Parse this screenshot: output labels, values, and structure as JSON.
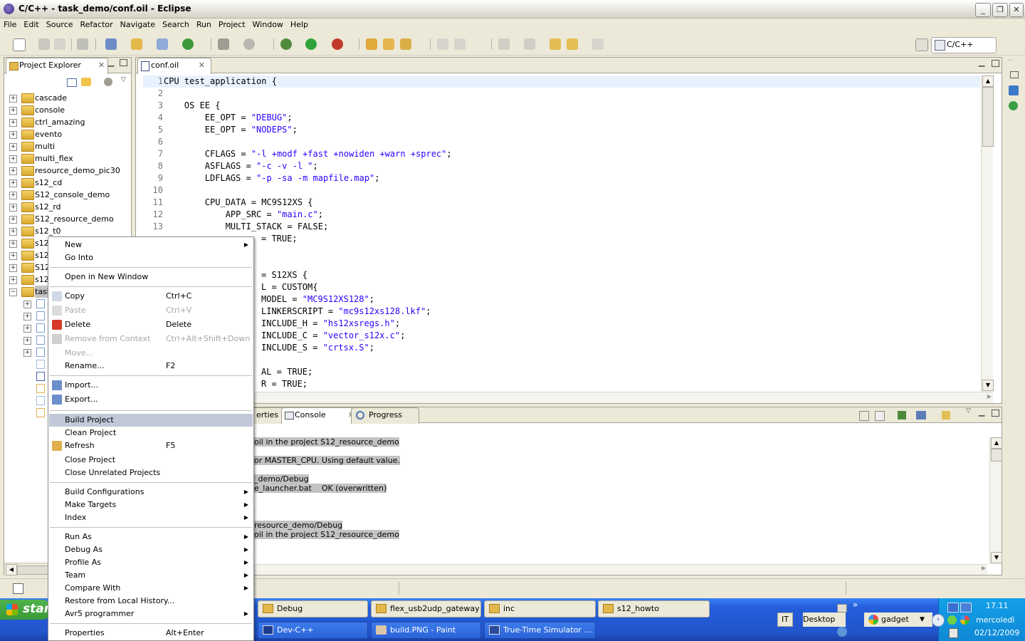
{
  "window": {
    "title": "C/C++ - task_demo/conf.oil - Eclipse"
  },
  "menubar": [
    "File",
    "Edit",
    "Source",
    "Refactor",
    "Navigate",
    "Search",
    "Run",
    "Project",
    "Window",
    "Help"
  ],
  "perspective": {
    "label": "C/C++"
  },
  "project_explorer": {
    "tab_label": "Project Explorer",
    "items": [
      "cascade",
      "console",
      "ctrl_amazing",
      "evento",
      "multi",
      "multi_flex",
      "resource_demo_pic30",
      "s12_cd",
      "S12_console_demo",
      "s12_rd",
      "S12_resource_demo",
      "s12_t0",
      "s12",
      "s12",
      "S12",
      "s12",
      "task"
    ]
  },
  "editor": {
    "tab_label": "conf.oil",
    "lines": [
      {
        "n": "1",
        "text": "CPU test_application {"
      },
      {
        "n": "2",
        "text": ""
      },
      {
        "n": "3",
        "text": "    OS EE {"
      },
      {
        "n": "4",
        "text": "        EE_OPT = \"DEBUG\";"
      },
      {
        "n": "5",
        "text": "        EE_OPT = \"NODEPS\";"
      },
      {
        "n": "6",
        "text": ""
      },
      {
        "n": "7",
        "text": "        CFLAGS = \"-l +modf +fast +nowiden +warn +sprec\";"
      },
      {
        "n": "8",
        "text": "        ASFLAGS = \"-c -v -l \";"
      },
      {
        "n": "9",
        "text": "        LDFLAGS = \"-p -sa -m mapfile.map\";"
      },
      {
        "n": "10",
        "text": ""
      },
      {
        "n": "11",
        "text": "        CPU_DATA = MC9S12XS {"
      },
      {
        "n": "12",
        "text": "            APP_SRC = \"main.c\";"
      },
      {
        "n": "13",
        "text": "            MULTI_STACK = FALSE;"
      }
    ],
    "hidden_lines": [
      "= TRUE;",
      "",
      "",
      "= S12XS {",
      "L = CUSTOM{",
      "MODEL = \"MC9S12XS128\";",
      "LINKERSCRIPT = \"mc9s12xs128.lkf\";",
      "INCLUDE_H = \"hs12xsregs.h\";",
      "INCLUDE_C = \"vector_s12x.c\";",
      "INCLUDE_S = \"crtsx.S\";",
      "",
      "AL = TRUE;",
      "R = TRUE;"
    ]
  },
  "bottom_panel": {
    "tabs": [
      "erties",
      "Console",
      "Progress"
    ],
    "console_lines": [
      "oil in the project S12_resource_demo",
      "",
      "or MASTER_CPU. Using default value.",
      "",
      "_demo/Debug",
      "e_launcher.bat    OK (overwritten)",
      "",
      "",
      "",
      "resource_demo/Debug",
      "oil in the project S12_resource_demo"
    ]
  },
  "context_menu": {
    "items": [
      {
        "label": "New",
        "shortcut": "",
        "submenu": true,
        "disabled": false
      },
      {
        "label": "Go Into",
        "shortcut": "",
        "submenu": false,
        "disabled": false
      },
      {
        "sep": true
      },
      {
        "label": "Open in New Window",
        "shortcut": "",
        "submenu": false,
        "disabled": false
      },
      {
        "sep": true
      },
      {
        "label": "Copy",
        "shortcut": "Ctrl+C",
        "submenu": false,
        "disabled": false,
        "icon": "copy-icon"
      },
      {
        "label": "Paste",
        "shortcut": "Ctrl+V",
        "submenu": false,
        "disabled": true,
        "icon": "paste-icon"
      },
      {
        "label": "Delete",
        "shortcut": "Delete",
        "submenu": false,
        "disabled": false,
        "icon": "delete-icon"
      },
      {
        "label": "Remove from Context",
        "shortcut": "Ctrl+Alt+Shift+Down",
        "submenu": false,
        "disabled": true,
        "icon": "remove-context-icon"
      },
      {
        "label": "Move...",
        "shortcut": "",
        "submenu": false,
        "disabled": true
      },
      {
        "label": "Rename...",
        "shortcut": "F2",
        "submenu": false,
        "disabled": false
      },
      {
        "sep": true
      },
      {
        "label": "Import...",
        "shortcut": "",
        "submenu": false,
        "disabled": false,
        "icon": "import-icon"
      },
      {
        "label": "Export...",
        "shortcut": "",
        "submenu": false,
        "disabled": false,
        "icon": "export-icon"
      },
      {
        "sep": true
      },
      {
        "label": "Build Project",
        "shortcut": "",
        "submenu": false,
        "disabled": false,
        "selected": true
      },
      {
        "label": "Clean Project",
        "shortcut": "",
        "submenu": false,
        "disabled": false
      },
      {
        "label": "Refresh",
        "shortcut": "F5",
        "submenu": false,
        "disabled": false,
        "icon": "refresh-icon"
      },
      {
        "label": "Close Project",
        "shortcut": "",
        "submenu": false,
        "disabled": false
      },
      {
        "label": "Close Unrelated Projects",
        "shortcut": "",
        "submenu": false,
        "disabled": false
      },
      {
        "sep": true
      },
      {
        "label": "Build Configurations",
        "shortcut": "",
        "submenu": true,
        "disabled": false
      },
      {
        "label": "Make Targets",
        "shortcut": "",
        "submenu": true,
        "disabled": false
      },
      {
        "label": "Index",
        "shortcut": "",
        "submenu": true,
        "disabled": false
      },
      {
        "sep": true
      },
      {
        "label": "Run As",
        "shortcut": "",
        "submenu": true,
        "disabled": false
      },
      {
        "label": "Debug As",
        "shortcut": "",
        "submenu": true,
        "disabled": false
      },
      {
        "label": "Profile As",
        "shortcut": "",
        "submenu": true,
        "disabled": false
      },
      {
        "label": "Team",
        "shortcut": "",
        "submenu": true,
        "disabled": false
      },
      {
        "label": "Compare With",
        "shortcut": "",
        "submenu": true,
        "disabled": false
      },
      {
        "label": "Restore from Local History...",
        "shortcut": "",
        "submenu": false,
        "disabled": false
      },
      {
        "label": "Avr5 programmer",
        "shortcut": "",
        "submenu": true,
        "disabled": false
      },
      {
        "sep": true
      },
      {
        "label": "Properties",
        "shortcut": "Alt+Enter",
        "submenu": false,
        "disabled": false
      }
    ]
  },
  "taskbar": {
    "start_label": "star",
    "row1": [
      "Debug",
      "flex_usb2udp_gateway",
      "inc",
      "s12_howto"
    ],
    "row2": [
      "Dev-C++",
      "build.PNG - Paint",
      "True-Time Simulator ..."
    ],
    "language": "IT",
    "desktop": "Desktop",
    "gadget": "gadget",
    "overflow": "»",
    "clock": {
      "time": "17.11",
      "day": "mercoledì",
      "date": "02/12/2009"
    }
  },
  "colors": {
    "menu_highlight": "#C2C8D8",
    "taskbar_blue": "#245EDC",
    "tray_blue": "#0F88D5",
    "console_highlight": "#C3C3C3"
  }
}
